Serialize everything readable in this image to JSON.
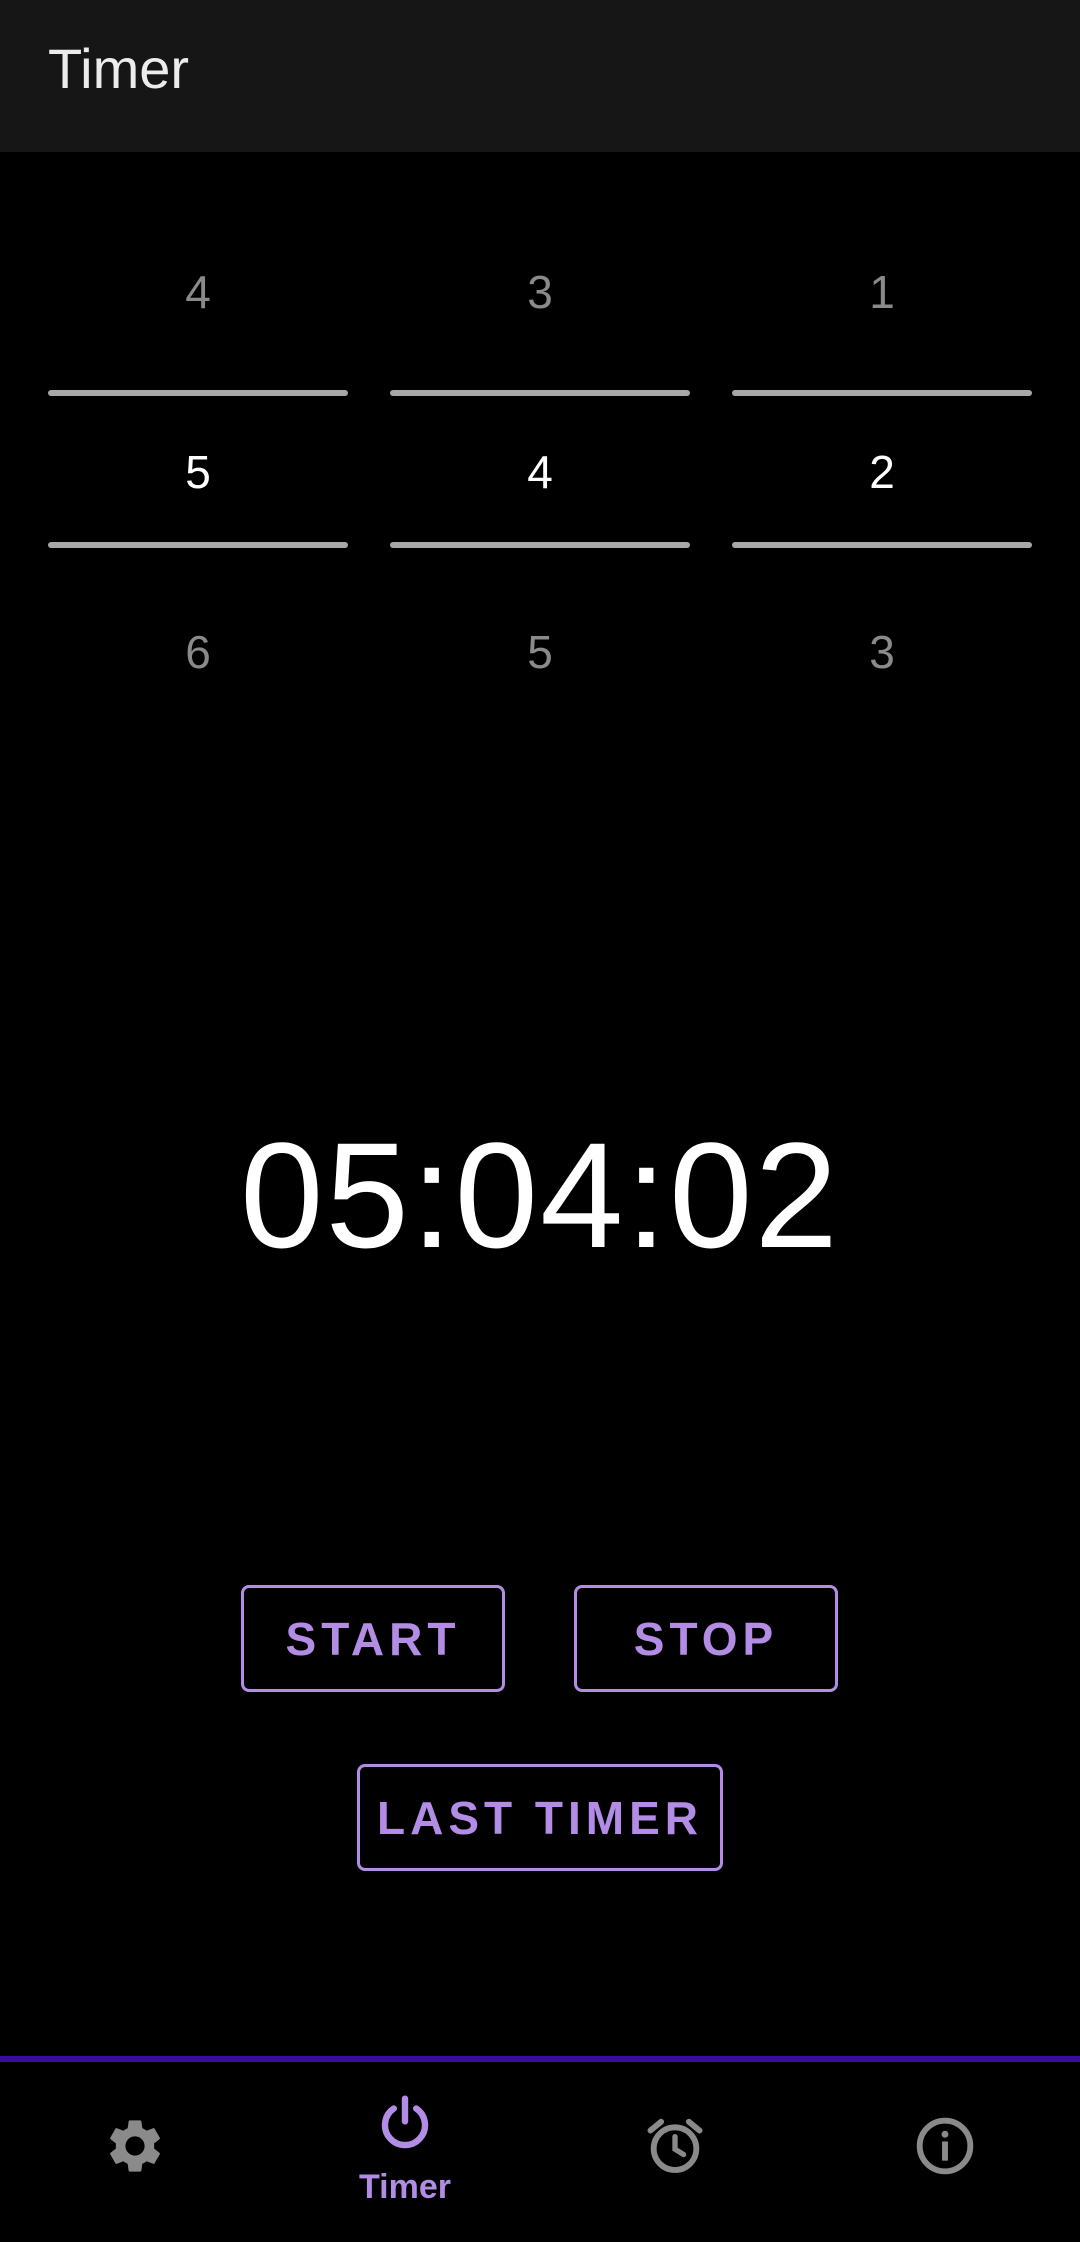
{
  "appbar": {
    "title": "Timer"
  },
  "picker": {
    "columns": [
      {
        "prev": "4",
        "current": "5",
        "next": "6"
      },
      {
        "prev": "3",
        "current": "4",
        "next": "5"
      },
      {
        "prev": "1",
        "current": "2",
        "next": "3"
      }
    ]
  },
  "countdown": {
    "value": "05:04:02"
  },
  "buttons": {
    "start_label": "START",
    "stop_label": "STOP",
    "last_timer_label": "LAST TIMER"
  },
  "bottom_nav": {
    "items": [
      {
        "icon": "gear-icon",
        "label": ""
      },
      {
        "icon": "power-icon",
        "label": "Timer",
        "selected": true
      },
      {
        "icon": "alarm-clock-icon",
        "label": ""
      },
      {
        "icon": "info-icon",
        "label": ""
      }
    ]
  },
  "colors": {
    "accent": "#b38ce6",
    "nav_divider": "#3a0ca3",
    "appbar_bg": "#161616",
    "background": "#000000",
    "inactive_icon": "#8a8a8a"
  }
}
